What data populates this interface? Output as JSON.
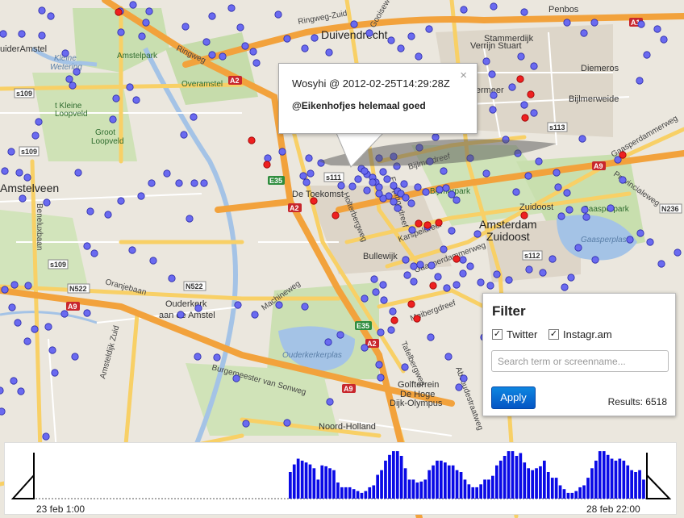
{
  "map": {
    "places": [
      {
        "key": "amstelveen",
        "text": "Amstelveen"
      },
      {
        "key": "duivendrecht",
        "text": "Duivendrecht"
      },
      {
        "key": "oudekerk",
        "text": "Ouderkerk"
      },
      {
        "key": "aan-de-amstel",
        "text": "aan de Amstel"
      },
      {
        "key": "amsterdam-zuidoost-1",
        "text": "Amsterdam"
      },
      {
        "key": "amsterdam-zuidoost-2",
        "text": "Zuidoost"
      },
      {
        "key": "buitenveldert",
        "text": "uiderAmstel"
      },
      {
        "key": "bijlmermeer",
        "text": "Bijlmermeer"
      },
      {
        "key": "gein",
        "text": "Diemeros"
      },
      {
        "key": "penbos",
        "text": "Penbos"
      },
      {
        "key": "stammerdijk",
        "text": "Stammerdijk"
      },
      {
        "key": "verrijn",
        "text": "Verrijn Stuart"
      },
      {
        "key": "bijlmerweide",
        "text": "Bijlmerweide"
      },
      {
        "key": "zuidoost-label",
        "text": "Zuidoost"
      },
      {
        "key": "bullewijk",
        "text": "Bullewijk"
      },
      {
        "key": "golfterrein",
        "text": "Golfterrein"
      },
      {
        "key": "de-hoge-dijk",
        "text": "De Hoge"
      },
      {
        "key": "dijk-olympus",
        "text": "Dijk-Olympus"
      },
      {
        "key": "noord-holland",
        "text": "Noord-Holland"
      },
      {
        "key": "de-toekomst",
        "text": "De Toekomst"
      }
    ],
    "parks": [
      {
        "key": "amstelpark",
        "text": "Amstelpark"
      },
      {
        "key": "overamstel",
        "text": "Overamstel"
      },
      {
        "key": "kleine-loopveld",
        "text": "t Kleine"
      },
      {
        "key": "kleine-loopveld-2",
        "text": "Loopveld"
      },
      {
        "key": "groot-loopveld",
        "text": "Groot"
      },
      {
        "key": "groot-loopveld-2",
        "text": "Loopveld"
      },
      {
        "key": "bijlmerpark",
        "text": "Bijlmerpark"
      },
      {
        "key": "gaasperpark",
        "text": "Gaasperpark"
      }
    ],
    "water": [
      {
        "key": "kleine-wetering",
        "text": "Kleine"
      },
      {
        "key": "kleine-wetering-2",
        "text": "Wetering"
      },
      {
        "key": "gaasperplas",
        "text": "Gaasperplas"
      },
      {
        "key": "ouderkerkerplas",
        "text": "Ouderkerkerplas"
      }
    ],
    "streets": [
      {
        "key": "ringweg-zuid",
        "text": "Ringweg-Zuid"
      },
      {
        "key": "ringweg",
        "text": "Ringweg"
      },
      {
        "key": "gooiseweg",
        "text": "Gooiseweg"
      },
      {
        "key": "holterbergweg",
        "text": "Holterbergweg"
      },
      {
        "key": "bijlmerdreef",
        "text": "Bijlmerdreef"
      },
      {
        "key": "foppingadreef",
        "text": "Foppingadreef"
      },
      {
        "key": "karspeldreef",
        "text": "Karspeldreef"
      },
      {
        "key": "gaasperdammerweg",
        "text": "Gaasperdammerweg"
      },
      {
        "key": "gaasperdammerweg-2",
        "text": "Gaasperdammerweg"
      },
      {
        "key": "provincialeweg",
        "text": "Provincialeweg"
      },
      {
        "key": "machineweg",
        "text": "Machineweg"
      },
      {
        "key": "burgemeester",
        "text": "Burgemeester van Sonweg"
      },
      {
        "key": "oranjebaan",
        "text": "Oranjebaan"
      },
      {
        "key": "amsteldijk",
        "text": "Amsteldijk Zuid"
      },
      {
        "key": "meibergdreef",
        "text": "Meibergdreef"
      },
      {
        "key": "tafelbergweg",
        "text": "Tafelbergweg"
      },
      {
        "key": "abcoudestraatweg",
        "text": "Abcoudestraatweg"
      },
      {
        "key": "beneluxbaan",
        "text": "Beneluxbaan"
      },
      {
        "key": "groot-loopveld-road",
        "text": "Groot"
      }
    ],
    "shields": [
      {
        "key": "s109a",
        "text": "s109"
      },
      {
        "key": "s109b",
        "text": "s109"
      },
      {
        "key": "s109c",
        "text": "s109"
      },
      {
        "key": "s111",
        "text": "s111"
      },
      {
        "key": "s112",
        "text": "s112"
      },
      {
        "key": "s113",
        "text": "s113"
      },
      {
        "key": "a2a",
        "text": "A2"
      },
      {
        "key": "a2b",
        "text": "A2"
      },
      {
        "key": "a2c",
        "text": "A2"
      },
      {
        "key": "a9a",
        "text": "A9"
      },
      {
        "key": "a9b",
        "text": "A9"
      },
      {
        "key": "a9c",
        "text": "A9"
      },
      {
        "key": "a9d",
        "text": "A9"
      },
      {
        "key": "a1",
        "text": "A1"
      },
      {
        "key": "e35a",
        "text": "E35"
      },
      {
        "key": "e35b",
        "text": "E35"
      },
      {
        "key": "n522",
        "text": "N522"
      },
      {
        "key": "n522b",
        "text": "N522"
      },
      {
        "key": "n236",
        "text": "N236"
      }
    ]
  },
  "infowindow": {
    "header": "Wosyhi @ 2012-02-25T14:29:28Z",
    "message": "@Eikenhofjes helemaal goed",
    "close_label": "×"
  },
  "filter": {
    "title": "Filter",
    "twitter_label": "Twitter",
    "twitter_checked": true,
    "instagram_label": "Instagr.am",
    "instagram_checked": true,
    "search_placeholder": "Search term or screenname...",
    "apply_label": "Apply",
    "results_text": "Results: 6518"
  },
  "timeline": {
    "start_label": "23 feb 1:00",
    "end_label": "28 feb 22:00",
    "bar_color": "#0a0ae6",
    "bars": [
      0.28,
      0.36,
      0.42,
      0.4,
      0.38,
      0.36,
      0.32,
      0.2,
      0.35,
      0.34,
      0.32,
      0.3,
      0.17,
      0.12,
      0.12,
      0.12,
      0.1,
      0.08,
      0.06,
      0.08,
      0.12,
      0.14,
      0.25,
      0.3,
      0.4,
      0.46,
      0.5,
      0.5,
      0.45,
      0.32,
      0.2,
      0.2,
      0.17,
      0.18,
      0.2,
      0.3,
      0.35,
      0.4,
      0.4,
      0.38,
      0.35,
      0.35,
      0.3,
      0.28,
      0.2,
      0.15,
      0.12,
      0.12,
      0.15,
      0.2,
      0.2,
      0.24,
      0.35,
      0.4,
      0.45,
      0.5,
      0.5,
      0.45,
      0.48,
      0.38,
      0.32,
      0.3,
      0.32,
      0.34,
      0.4,
      0.28,
      0.22,
      0.22,
      0.14,
      0.1,
      0.06,
      0.06,
      0.08,
      0.12,
      0.14,
      0.22,
      0.32,
      0.4,
      0.5,
      0.5,
      0.46,
      0.42,
      0.4,
      0.42,
      0.4,
      0.35,
      0.3,
      0.28,
      0.3,
      0.2
    ]
  }
}
